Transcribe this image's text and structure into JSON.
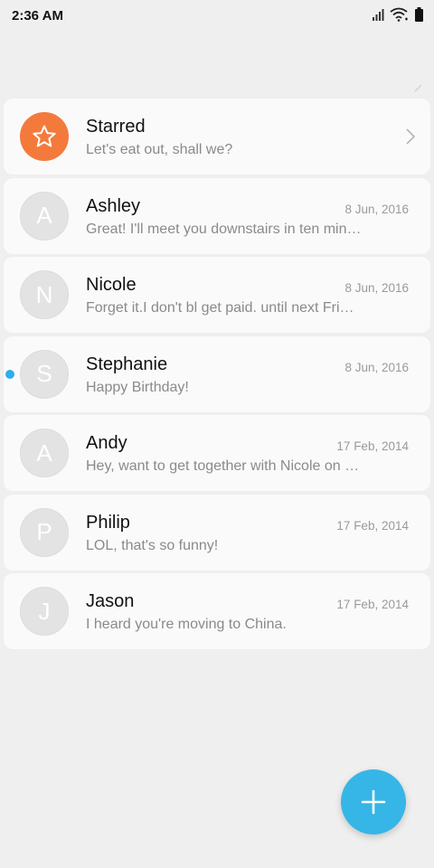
{
  "status": {
    "time": "2:36 AM"
  },
  "conversations": [
    {
      "name": "Starred",
      "preview": "Let's eat out, shall we?",
      "date": "",
      "avatar": "star-icon"
    },
    {
      "name": "Ashley",
      "preview": "Great! I'll meet you downstairs in ten minutes.",
      "date": "8 Jun, 2016",
      "avatar": "A"
    },
    {
      "name": "Nicole",
      "preview": "Forget it.I don't bl get paid. until next Friday.",
      "date": "8 Jun, 2016",
      "avatar": "N"
    },
    {
      "name": "Stephanie",
      "preview": "Happy Birthday!",
      "date": "8 Jun, 2016",
      "avatar": "S"
    },
    {
      "name": "Andy",
      "preview": "Hey, want to get together with Nicole on Sunday?",
      "date": "17 Feb, 2014",
      "avatar": "A"
    },
    {
      "name": "Philip",
      "preview": "LOL, that's so funny!",
      "date": "17 Feb, 2014",
      "avatar": "P"
    },
    {
      "name": "Jason",
      "preview": "I heard you're moving to China.",
      "date": "17 Feb, 2014",
      "avatar": "J"
    }
  ],
  "colors": {
    "starred_avatar": "#f47a3c",
    "unread_dot": "#2eaeea",
    "fab": "#36b6e6"
  },
  "icons": {
    "signal": "signal-icon",
    "wifi": "wifi-icon",
    "battery": "battery-icon",
    "star": "star-icon",
    "chevron": "chevron-right-icon",
    "fab": "plus-icon"
  }
}
